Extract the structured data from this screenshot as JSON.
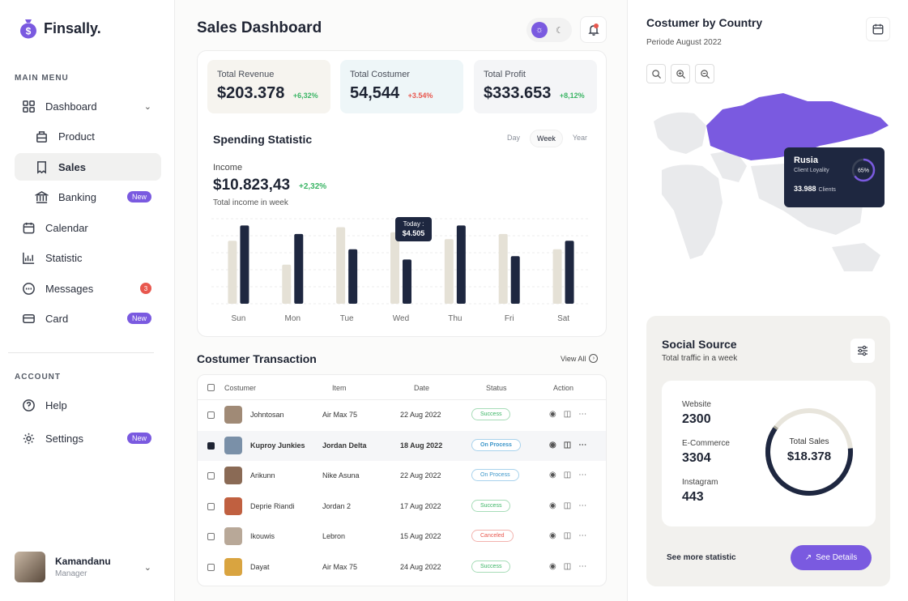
{
  "app": {
    "name": "Finsally."
  },
  "sidebar": {
    "main_menu_title": "MAIN MENU",
    "account_title": "ACCOUNT",
    "items": [
      {
        "label": "Dashboard",
        "icon": "grid-icon"
      },
      {
        "label": "Product",
        "icon": "box-icon"
      },
      {
        "label": "Sales",
        "icon": "receipt-icon"
      },
      {
        "label": "Banking",
        "icon": "bank-icon",
        "badge": "New"
      },
      {
        "label": "Calendar",
        "icon": "calendar-icon"
      },
      {
        "label": "Statistic",
        "icon": "chart-icon"
      },
      {
        "label": "Messages",
        "icon": "message-icon",
        "count": "3"
      },
      {
        "label": "Card",
        "icon": "card-icon",
        "badge": "New"
      }
    ],
    "account_items": [
      {
        "label": "Help",
        "icon": "help-icon"
      },
      {
        "label": "Settings",
        "icon": "gear-icon",
        "badge": "New"
      }
    ],
    "profile": {
      "name": "Kamandanu",
      "role": "Manager"
    }
  },
  "header": {
    "title": "Sales Dashboard"
  },
  "stats": [
    {
      "label": "Total Revenue",
      "value": "$203.378",
      "change": "+6,32%",
      "trend": "up",
      "bg": "#f6f4ef"
    },
    {
      "label": "Total Costumer",
      "value": "54,544",
      "change": "+3.54%",
      "trend": "down",
      "bg": "#eef6f8"
    },
    {
      "label": "Total Profit",
      "value": "$333.653",
      "change": "+8,12%",
      "trend": "up",
      "bg": "#f4f5f7"
    }
  ],
  "spending": {
    "title": "Spending Statistic",
    "tabs": [
      "Day",
      "Week",
      "Year"
    ],
    "active_tab": "Week",
    "income_label": "Income",
    "income_value": "$10.823,43",
    "income_change": "+2,32%",
    "income_sub": "Total income in week",
    "tooltip_label": "Today :",
    "tooltip_value": "$4.505"
  },
  "chart_data": {
    "type": "bar",
    "categories": [
      "Sun",
      "Mon",
      "Tue",
      "Wed",
      "Thu",
      "Fri",
      "Sat"
    ],
    "series": [
      {
        "values": [
          3.7,
          2.3,
          4.5,
          4.2,
          3.8,
          4.1,
          3.2
        ],
        "color": "#e5e1d6"
      },
      {
        "values": [
          4.6,
          4.1,
          3.2,
          2.6,
          4.6,
          2.8,
          3.7
        ],
        "color": "#1e2740"
      }
    ],
    "ylim": [
      0,
      5
    ]
  },
  "transactions": {
    "title": "Costumer Transaction",
    "view_all": "View All",
    "columns": [
      "Costumer",
      "Item",
      "Date",
      "Status",
      "Action"
    ],
    "rows": [
      {
        "name": "Johntosan",
        "item": "Air Max 75",
        "date": "22 Aug 2022",
        "status": "Success",
        "checked": false,
        "av": "#a08a76"
      },
      {
        "name": "Kuproy Junkies",
        "item": "Jordan Delta",
        "date": "18 Aug 2022",
        "status": "On Process",
        "checked": true,
        "av": "#7a90a8"
      },
      {
        "name": "Arikunn",
        "item": "Nike Asuna",
        "date": "22 Aug 2022",
        "status": "On Process",
        "checked": false,
        "av": "#8a6a55"
      },
      {
        "name": "Deprie Riandi",
        "item": "Jordan 2",
        "date": "17 Aug 2022",
        "status": "Success",
        "checked": false,
        "av": "#c06040"
      },
      {
        "name": "Ikouwis",
        "item": "Lebron",
        "date": "15 Aug 2022",
        "status": "Canceled",
        "checked": false,
        "av": "#b8a898"
      },
      {
        "name": "Dayat",
        "item": "Air Max 75",
        "date": "24 Aug 2022",
        "status": "Success",
        "checked": false,
        "av": "#d9a440"
      }
    ]
  },
  "country": {
    "title": "Costumer by Country",
    "period": "Periode August 2022",
    "tip_country": "Rusia",
    "tip_sub": "Client Loyality",
    "tip_percent": "65%",
    "tip_clients": "33.988",
    "tip_clients_label": "Clients"
  },
  "social": {
    "title": "Social Source",
    "subtitle": "Total traffic in a week",
    "sources": [
      {
        "label": "Website",
        "value": "2300"
      },
      {
        "label": "E-Commerce",
        "value": "3304"
      },
      {
        "label": "Instagram",
        "value": "443"
      }
    ],
    "total_label": "Total Sales",
    "total_value": "$18.378",
    "see_more": "See more statistic",
    "details_button": "See Details"
  },
  "colors": {
    "accent": "#7a5ae0",
    "navy": "#1e2740",
    "success": "#3bb565",
    "danger": "#e8574e"
  }
}
